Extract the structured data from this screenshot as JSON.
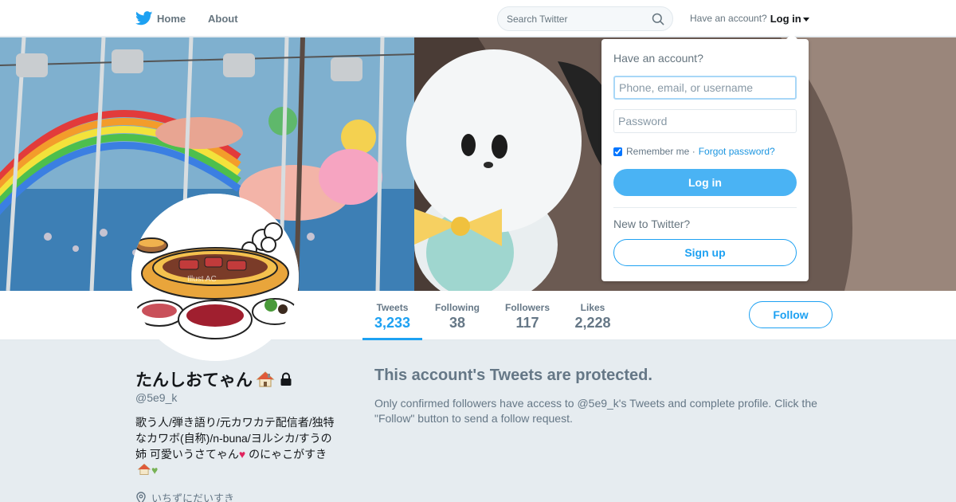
{
  "nav": {
    "home_label": "Home",
    "about_label": "About",
    "search_placeholder": "Search Twitter",
    "account_prompt": "Have an account?",
    "login_label": "Log in"
  },
  "profile": {
    "name": "たんしおてゃん",
    "handle": "@5e9_k",
    "bio_line1": "歌う人/弾き語り/元カワカテ配信者/独特なカワボ(自称)/n-buna/ヨルシカ/すうの姉 可愛いうさてゃん",
    "bio_heart": "♥",
    "bio_line2": " のにゃこがすき",
    "bio_green": "♥",
    "location": "いちずにだいすき",
    "avatar_watermark": "Illust AC"
  },
  "stats": [
    {
      "label": "Tweets",
      "value": "3,233",
      "active": true
    },
    {
      "label": "Following",
      "value": "38",
      "active": false
    },
    {
      "label": "Followers",
      "value": "117",
      "active": false
    },
    {
      "label": "Likes",
      "value": "2,228",
      "active": false
    }
  ],
  "follow_label": "Follow",
  "protected": {
    "title": "This account's Tweets are protected.",
    "text": "Only confirmed followers have access to @5e9_k's Tweets and complete profile. Click the \"Follow\" button to send a follow request."
  },
  "login_dropdown": {
    "heading": "Have an account?",
    "username_placeholder": "Phone, email, or username",
    "password_placeholder": "Password",
    "remember_label": "Remember me ·",
    "remember_checked": true,
    "forgot_label": "Forgot password?",
    "login_button": "Log in",
    "new_prompt": "New to Twitter?",
    "signup_button": "Sign up"
  },
  "colors": {
    "brand_blue": "#1da1f2",
    "login_button_blue": "#4ab3f4",
    "page_background": "#e6ecf0",
    "muted_text": "#657786"
  },
  "icons": {
    "logo": "twitter-bird-icon",
    "search": "search-icon",
    "lock": "lock-icon",
    "location": "map-pin-icon",
    "name_emoji": "house-icon"
  }
}
